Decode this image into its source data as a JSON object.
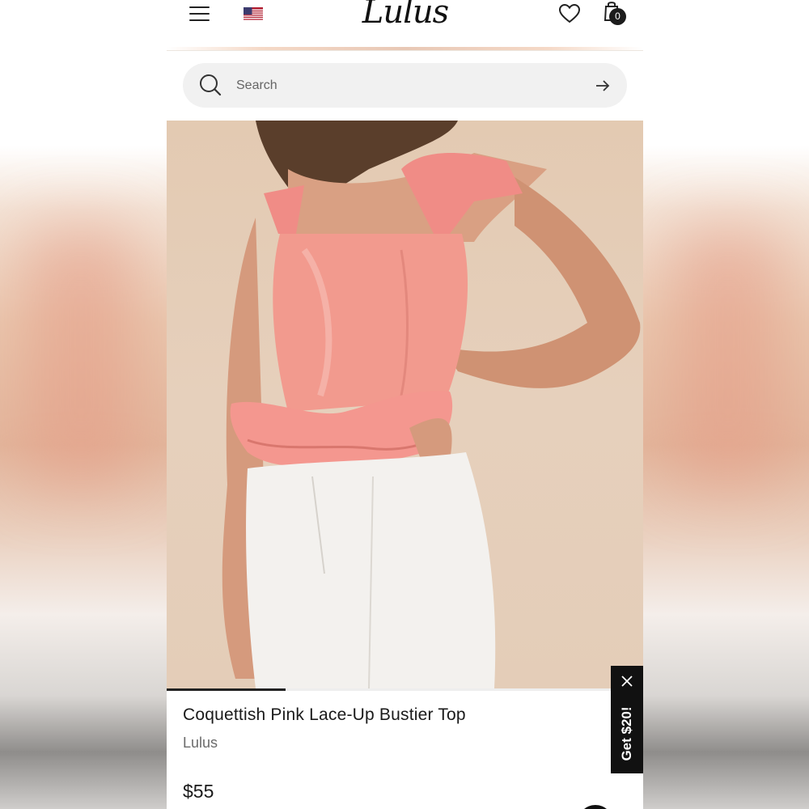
{
  "header": {
    "logo_text": "Lulus",
    "bag_count": "0",
    "icons": {
      "menu": "hamburger-menu-icon",
      "flag": "us-flag-icon",
      "wishlist": "heart-icon",
      "bag": "shopping-bag-icon"
    }
  },
  "search": {
    "placeholder": "Search",
    "icon": "search-icon",
    "submit_icon": "arrow-right-icon"
  },
  "product": {
    "title": "Coquettish Pink Lace-Up Bustier Top",
    "brand": "Lulus",
    "price": "$55",
    "image_carousel_progress": 0.25
  },
  "promo": {
    "label": "Get $20!",
    "close_icon": "close-icon"
  },
  "colors": {
    "accent": "#111111",
    "top_pink": "#f08c86",
    "background_tan": "#e3cab2"
  }
}
